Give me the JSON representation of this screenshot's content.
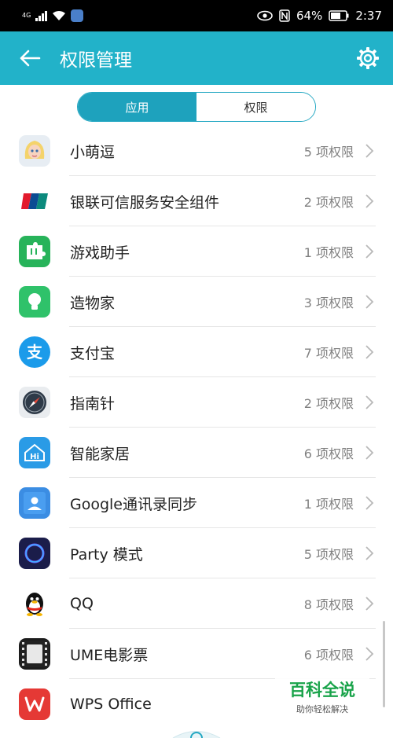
{
  "status_bar": {
    "network": "4G",
    "battery": "64%",
    "time": "2:37"
  },
  "header": {
    "title": "权限管理",
    "back_icon": "arrow-left-icon",
    "settings_icon": "gear-icon"
  },
  "tabs": {
    "items": [
      {
        "label": "应用",
        "active": true
      },
      {
        "label": "权限",
        "active": false
      }
    ]
  },
  "apps": [
    {
      "name": "小萌逗",
      "permissions": "5 项权限",
      "icon": "cartoon-girl-icon"
    },
    {
      "name": "银联可信服务安全组件",
      "permissions": "2 项权限",
      "icon": "unionpay-icon",
      "icon_text": "UnionPay"
    },
    {
      "name": "游戏助手",
      "permissions": "1 项权限",
      "icon": "puzzle-icon"
    },
    {
      "name": "造物家",
      "permissions": "3 项权限",
      "icon": "lightbulb-icon"
    },
    {
      "name": "支付宝",
      "permissions": "7 项权限",
      "icon": "alipay-icon",
      "icon_text": "支"
    },
    {
      "name": "指南针",
      "permissions": "2 项权限",
      "icon": "compass-icon"
    },
    {
      "name": "智能家居",
      "permissions": "6 项权限",
      "icon": "smart-home-icon",
      "icon_text": "Hi"
    },
    {
      "name": "Google通讯录同步",
      "permissions": "1 项权限",
      "icon": "contacts-icon"
    },
    {
      "name": "Party 模式",
      "permissions": "5 项权限",
      "icon": "party-ring-icon"
    },
    {
      "name": "QQ",
      "permissions": "8 项权限",
      "icon": "qq-penguin-icon"
    },
    {
      "name": "UME电影票",
      "permissions": "6 项权限",
      "icon": "film-strip-icon"
    },
    {
      "name": "WPS Office",
      "permissions": "",
      "icon": "wps-icon",
      "icon_text": "W"
    }
  ],
  "watermark": {
    "title": "百科全说",
    "subtitle": "助你轻松解决"
  },
  "colors": {
    "accent": "#22b2c9",
    "tab_active": "#1ea2bd"
  }
}
